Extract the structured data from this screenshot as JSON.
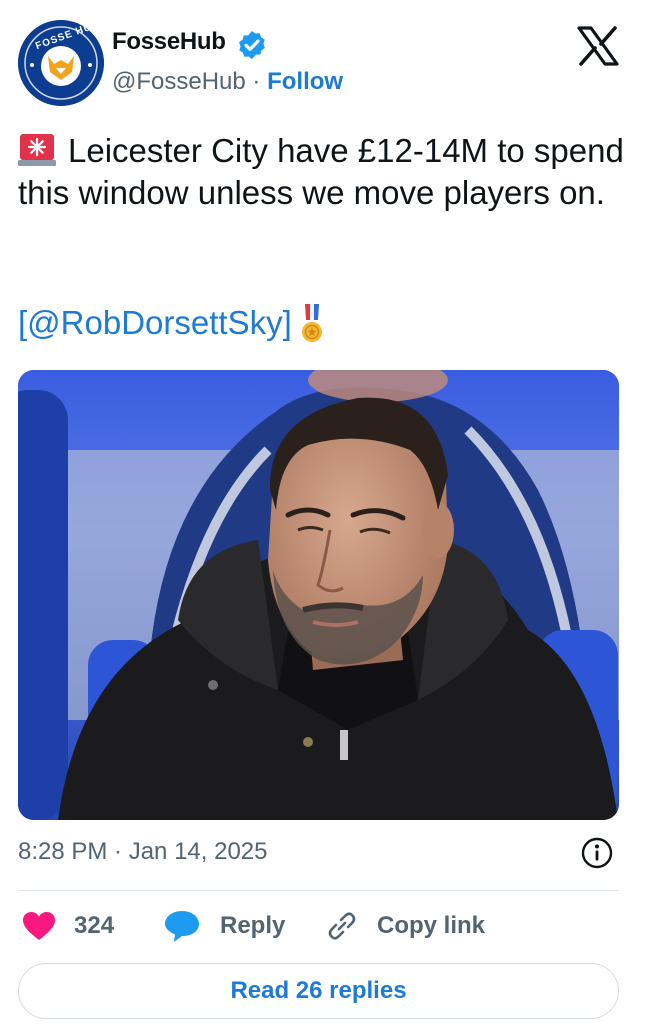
{
  "author": {
    "display_name": "FosseHub",
    "handle": "@FosseHub",
    "separator": " · ",
    "follow_label": "Follow",
    "avatar_text": "FOSSE HUB",
    "verified": true
  },
  "tweet": {
    "text": "Leicester City have  £12-14M to spend this window unless we move players on.",
    "mention": "[@RobDorsettSky]",
    "leading_emoji": "siren-icon",
    "trailing_emoji": "medal-icon"
  },
  "meta": {
    "timestamp": "8:28 PM · Jan 14, 2025"
  },
  "actions": {
    "like_count": "324",
    "reply_label": "Reply",
    "copy_label": "Copy link"
  },
  "footer": {
    "read_replies_label": "Read 26 replies"
  },
  "colors": {
    "accent": "#1d7bd6",
    "like": "#f91880",
    "text_primary": "#0f1419",
    "text_secondary": "#536471"
  }
}
